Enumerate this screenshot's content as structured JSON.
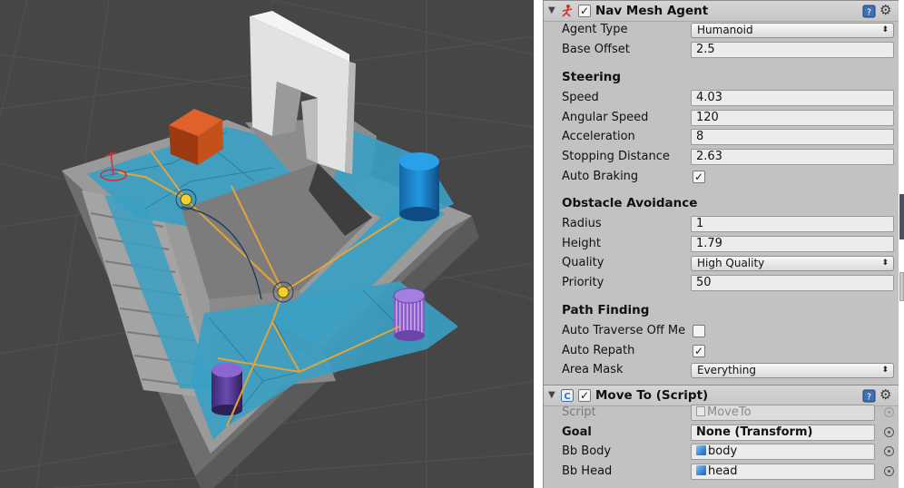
{
  "nav_mesh_agent": {
    "title": "Nav Mesh Agent",
    "agent_type_label": "Agent Type",
    "agent_type_value": "Humanoid",
    "base_offset_label": "Base Offset",
    "base_offset_value": "2.5",
    "steering": {
      "title": "Steering",
      "speed_label": "Speed",
      "speed_value": "4.03",
      "angular_speed_label": "Angular Speed",
      "angular_speed_value": "120",
      "acceleration_label": "Acceleration",
      "acceleration_value": "8",
      "stopping_distance_label": "Stopping Distance",
      "stopping_distance_value": "2.63",
      "auto_braking_label": "Auto Braking",
      "auto_braking_checked": true
    },
    "obstacle_avoidance": {
      "title": "Obstacle Avoidance",
      "radius_label": "Radius",
      "radius_value": "1",
      "height_label": "Height",
      "height_value": "1.79",
      "quality_label": "Quality",
      "quality_value": "High Quality",
      "priority_label": "Priority",
      "priority_value": "50"
    },
    "path_finding": {
      "title": "Path Finding",
      "auto_traverse_label": "Auto Traverse Off Me",
      "auto_traverse_checked": false,
      "auto_repath_label": "Auto Repath",
      "auto_repath_checked": true,
      "area_mask_label": "Area Mask",
      "area_mask_value": "Everything"
    }
  },
  "move_to_script": {
    "title": "Move To (Script)",
    "script_label": "Script",
    "script_value": "MoveTo",
    "goal_label": "Goal",
    "goal_value": "None (Transform)",
    "bb_body_label": "Bb Body",
    "bb_body_value": "body",
    "bb_head_label": "Bb Head",
    "bb_head_value": "head"
  },
  "glyphs": {
    "fold_arrow": "▼",
    "checkmark": "✓",
    "dropdown_arrows": "⬍",
    "gear": "⚙"
  },
  "colors": {
    "scene_background": "#464646",
    "navmesh": "#3aa0c4",
    "path_lines": "#e3a43a",
    "inspector_background": "#c2c2c2",
    "orange_box": "#c4501c",
    "blue_cylinder": "#1e88cf",
    "purple_cylinder": "#7a4fc0"
  }
}
